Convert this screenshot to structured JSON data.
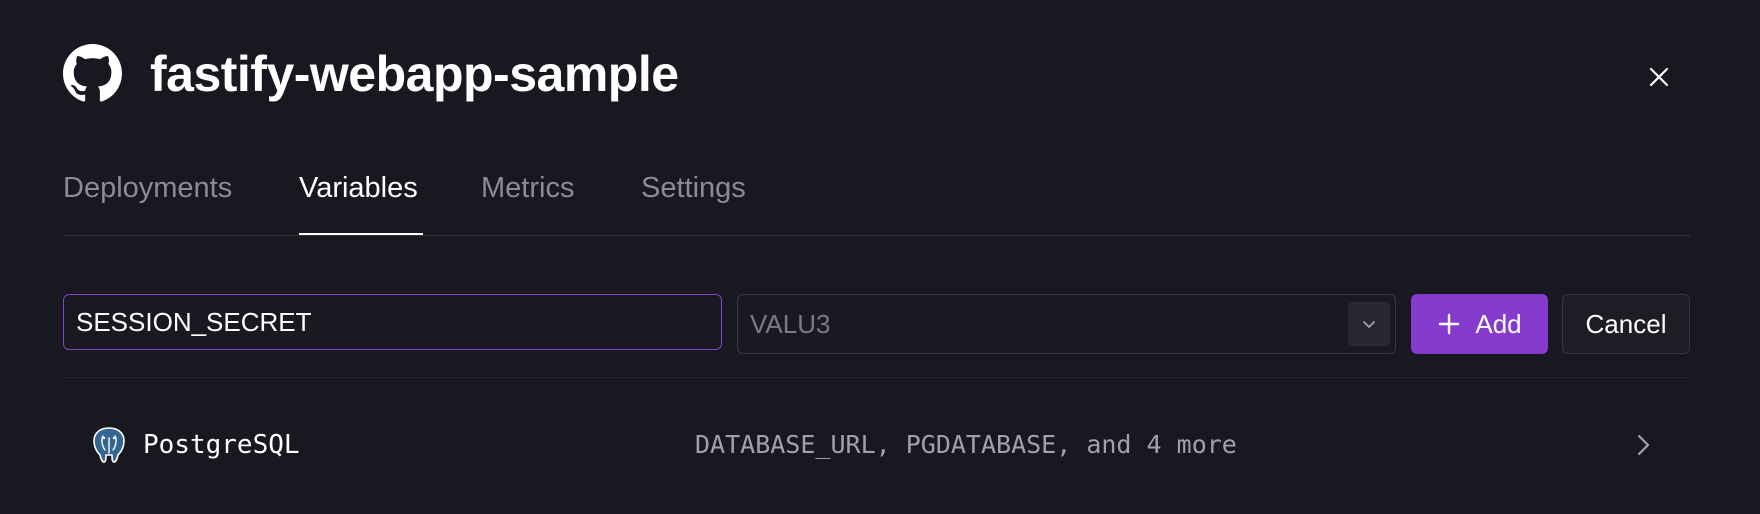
{
  "header": {
    "title": "fastify-webapp-sample",
    "repo_icon": "github-icon",
    "close_icon": "close-icon"
  },
  "tabs": [
    {
      "label": "Deployments",
      "active": false
    },
    {
      "label": "Variables",
      "active": true
    },
    {
      "label": "Metrics",
      "active": false
    },
    {
      "label": "Settings",
      "active": false
    }
  ],
  "variable_form": {
    "key_value": "SESSION_SECRET",
    "value_placeholder": "VALU3",
    "value_value": "",
    "dropdown_icon": "chevron-down-icon",
    "add_label": "Add",
    "add_icon": "plus-icon",
    "cancel_label": "Cancel"
  },
  "plugins": [
    {
      "name": "PostgreSQL",
      "icon": "postgresql-icon",
      "variables_summary": "DATABASE_URL, PGDATABASE, and 4 more",
      "chevron_icon": "chevron-right-icon"
    }
  ],
  "colors": {
    "background": "#19171f",
    "accent": "#853bce",
    "focus_border": "#7b48c4",
    "muted_text": "#8d8a96"
  }
}
